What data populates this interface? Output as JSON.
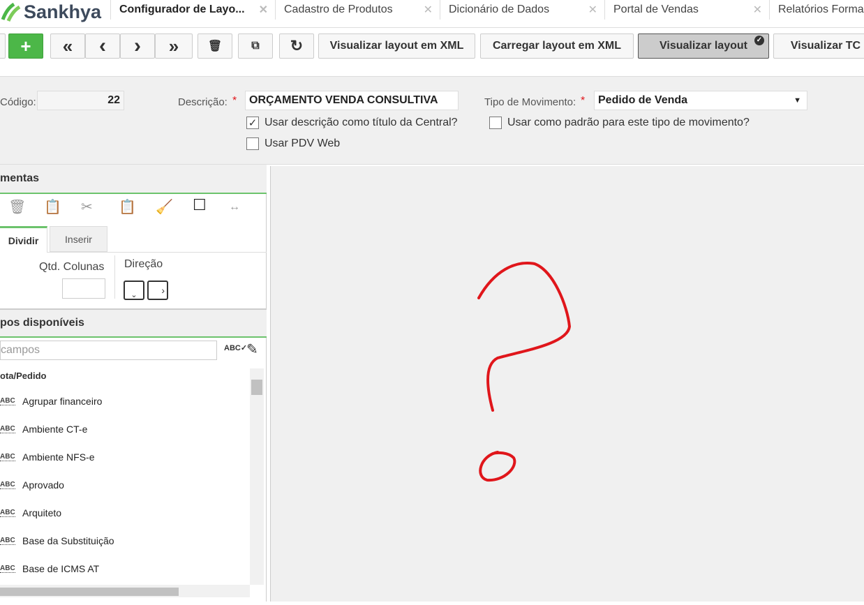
{
  "app": {
    "brand": "Sankhya"
  },
  "tabs": [
    {
      "label": "Configurador de Layo...",
      "active": true
    },
    {
      "label": "Cadastro de Produtos"
    },
    {
      "label": "Dicionário de Dados"
    },
    {
      "label": "Portal de Vendas"
    },
    {
      "label": "Relatórios Forma"
    }
  ],
  "toolbar": {
    "add": "+",
    "first": "«",
    "prev": "‹",
    "next": "›",
    "last": "»",
    "view_xml": "Visualizar layout em XML",
    "load_xml": "Carregar layout em XML",
    "view_layout": "Visualizar layout",
    "view_tc": "Visualizar TC"
  },
  "form": {
    "codigo_label": "Código:",
    "codigo": "22",
    "descricao_label": "Descrição:",
    "descricao": "ORÇAMENTO VENDA CONSULTIVA",
    "tipo_label": "Tipo de Movimento:",
    "tipo": "Pedido de Venda",
    "required": "*",
    "cb_titulo": "Usar descrição como título da Central?",
    "cb_titulo_checked": true,
    "cb_padrao": "Usar como padrão para este tipo de movimento?",
    "cb_padrao_checked": false,
    "cb_pdv": "Usar PDV Web",
    "cb_pdv_checked": false
  },
  "tools": {
    "title": "mentas",
    "tab_dividir": "Dividir",
    "tab_inserir": "Inserir",
    "qtd_label": "Qtd. Colunas",
    "direcao_label": "Direção"
  },
  "fields": {
    "title": "pos disponíveis",
    "search_placeholder": "campos",
    "group": "ota/Pedido",
    "items": [
      "Agrupar financeiro",
      "Ambiente CT-e",
      "Ambiente NFS-e",
      "Aprovado",
      "Arquiteto",
      "Base da Substituição",
      "Base de ICMS AT"
    ]
  },
  "colors": {
    "accent": "#4cb748",
    "annotation": "#e0161b"
  }
}
